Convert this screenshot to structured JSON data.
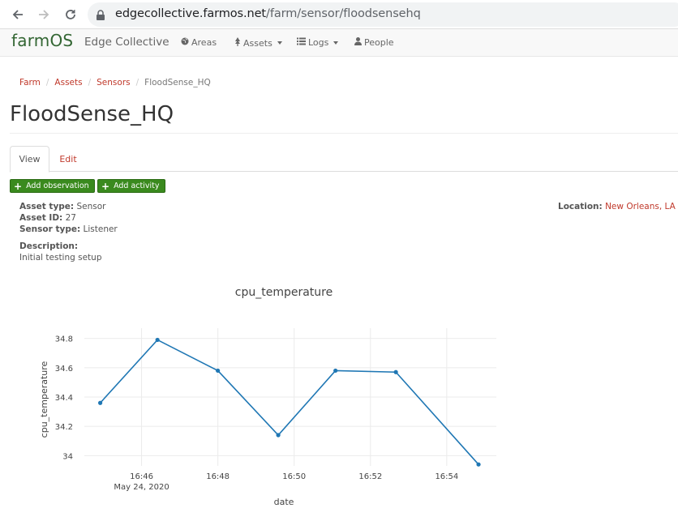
{
  "browser": {
    "url_host": "edgecollective.farmos.net",
    "url_path": "/farm/sensor/floodsensehq"
  },
  "navbar": {
    "logo": "farmOS",
    "site_name": "Edge Collective",
    "items": [
      {
        "label": "Areas",
        "icon": "globe-icon"
      },
      {
        "label": "Assets",
        "icon": "leaf-icon"
      },
      {
        "label": "Logs",
        "icon": "list-icon"
      },
      {
        "label": "People",
        "icon": "user-icon"
      }
    ]
  },
  "breadcrumb": {
    "items": [
      "Farm",
      "Assets",
      "Sensors"
    ],
    "current": "FloodSense_HQ"
  },
  "page": {
    "title": "FloodSense_HQ",
    "tabs": [
      "View",
      "Edit"
    ],
    "buttons": [
      "Add observation",
      "Add activity"
    ]
  },
  "fields": {
    "asset_type_label": "Asset type:",
    "asset_type": "Sensor",
    "asset_id_label": "Asset ID:",
    "asset_id": "27",
    "sensor_type_label": "Sensor type:",
    "sensor_type": "Listener",
    "description_label": "Description:",
    "description": "Initial testing setup",
    "location_label": "Location:",
    "location": "New Orleans, LA"
  },
  "colors": {
    "accent": "#c0392b",
    "button": "#3a8a1e",
    "line": "#1f77b4"
  },
  "chart_data": {
    "type": "line",
    "title": "cpu_temperature",
    "xlabel": "date",
    "ylabel": "cpu_temperature",
    "x_tick_labels": [
      "16:46",
      "16:48",
      "16:50",
      "16:52",
      "16:54"
    ],
    "x_tick_sublabel": "May 24, 2020",
    "y_tick_labels": [
      "34",
      "34.2",
      "34.4",
      "34.6",
      "34.8"
    ],
    "xlim": [
      "16:44.5",
      "16:55.3"
    ],
    "ylim": [
      33.93,
      34.87
    ],
    "grid": true,
    "series": [
      {
        "x": [
          "16:44:55",
          "16:46:25",
          "16:48:00",
          "16:49:35",
          "16:51:05",
          "16:52:40",
          "16:54:50"
        ],
        "y": [
          34.36,
          34.79,
          34.58,
          34.14,
          34.58,
          34.57,
          33.94
        ]
      }
    ]
  }
}
